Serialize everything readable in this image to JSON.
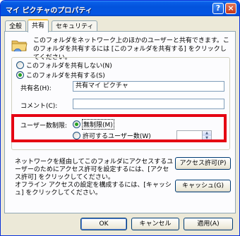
{
  "window": {
    "title": "マイ ピクチャのプロパティ"
  },
  "titlebar": {
    "help_label": "?",
    "close_label": "×"
  },
  "tabs": [
    {
      "label": "全般",
      "active": false
    },
    {
      "label": "共有",
      "active": true
    },
    {
      "label": "セキュリティ",
      "active": false
    }
  ],
  "share": {
    "description": "このフォルダをネットワーク上のほかのユーザーと共有できます。このフォルダを共有するには [このフォルダを共有する] をクリックしてください。",
    "radio_no_share": "このフォルダを共有しない(N)",
    "radio_share": "このフォルダを共有する(S)",
    "share_name_label": "共有名(H):",
    "share_name_value": "共有マイ ピクチャ",
    "comment_label": "コメント(C):",
    "comment_value": "",
    "user_limit_label": "ユーザー数制限:",
    "radio_unlimited": "無制限(M)",
    "radio_allowed_users": "許可するユーザー数(W)",
    "allowed_users_value": "",
    "permissions_text": "ネットワークを経由してこのフォルダにアクセスするユーザーのためにアクセス許可を設定するには、[アクセス許可] をクリックしてください。",
    "permissions_button": "アクセス許可(P)",
    "caching_text": "オフライン アクセスの設定を構成するには、[キャッシュ] をクリックしてください。",
    "caching_button": "キャッシュ(G)"
  },
  "footer": {
    "ok": "OK",
    "cancel": "キャンセル",
    "apply": "適用(A)"
  },
  "colors": {
    "titlebar": "#0353dc",
    "highlight_box": "#e50012",
    "dialog_bg": "#ece9d8"
  }
}
